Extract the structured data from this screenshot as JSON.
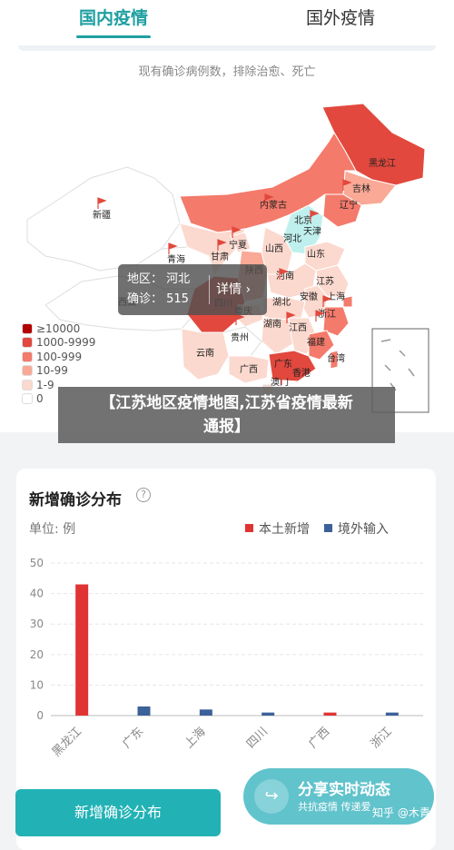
{
  "tabs": {
    "domestic": "国内疫情",
    "overseas": "国外疫情"
  },
  "map": {
    "subtitle": "现有确诊病例数，排除治愈、死亡",
    "legend": [
      {
        "label": "≥10000",
        "color": "#b30000"
      },
      {
        "label": "1000-9999",
        "color": "#e2483d"
      },
      {
        "label": "100-999",
        "color": "#f47a6b"
      },
      {
        "label": "10-99",
        "color": "#f9a996"
      },
      {
        "label": "1-9",
        "color": "#fbd9cf"
      },
      {
        "label": "0",
        "color": "#ffffff"
      }
    ],
    "provinces": {
      "heilongjiang": "黑龙江",
      "jilin": "吉林",
      "liaoning": "辽宁",
      "neimenggu": "内蒙古",
      "beijing": "北京",
      "tianjin": "天津",
      "hebei": "河北",
      "shanxi": "山西",
      "shandong": "山东",
      "xinjiang": "新疆",
      "qinghai": "青海",
      "gansu": "甘肃",
      "ningxia": "宁夏",
      "shaanxi": "陕西",
      "henan": "河南",
      "jiangsu": "江苏",
      "anhui": "安徽",
      "shanghai": "上海",
      "hubei": "湖北",
      "zhejiang": "浙江",
      "xizang": "西藏",
      "sichuan": "四川",
      "chongqing": "重庆",
      "hunan": "湖南",
      "jiangxi": "江西",
      "guizhou": "贵州",
      "fujian": "福建",
      "yunnan": "云南",
      "guangxi": "广西",
      "guangdong": "广东",
      "taiwan": "台湾",
      "xianggang": "香港",
      "aomen": "澳门"
    },
    "tooltip": {
      "region": "地区：  河北",
      "confirmed": "确诊：  515",
      "detail": "详情 ›"
    }
  },
  "banner": {
    "line1": "【江苏地区疫情地图,江苏省疫情最新",
    "line2": "通报】"
  },
  "card": {
    "title": "新增确诊分布",
    "help": "?",
    "unit": "单位: 例",
    "legend_local": "本土新增",
    "legend_import": "境外输入"
  },
  "chart_data": {
    "type": "bar",
    "categories": [
      "黑龙江",
      "广东",
      "上海",
      "四川",
      "广西",
      "浙江"
    ],
    "series": [
      {
        "name": "本土新增",
        "color": "#e03434",
        "values": [
          43,
          0,
          0,
          0,
          1,
          0
        ]
      },
      {
        "name": "境外输入",
        "color": "#3d6199",
        "values": [
          0,
          3,
          2,
          1,
          0,
          1
        ]
      }
    ],
    "ylim": [
      0,
      50
    ],
    "yticks": [
      0,
      10,
      20,
      30,
      40,
      50
    ],
    "grid": true
  },
  "bottom_button": "新增确诊分布",
  "share": {
    "title": "分享实时动态",
    "subtitle": "共抗疫情 传递爱"
  },
  "watermark": "知乎 @木青"
}
